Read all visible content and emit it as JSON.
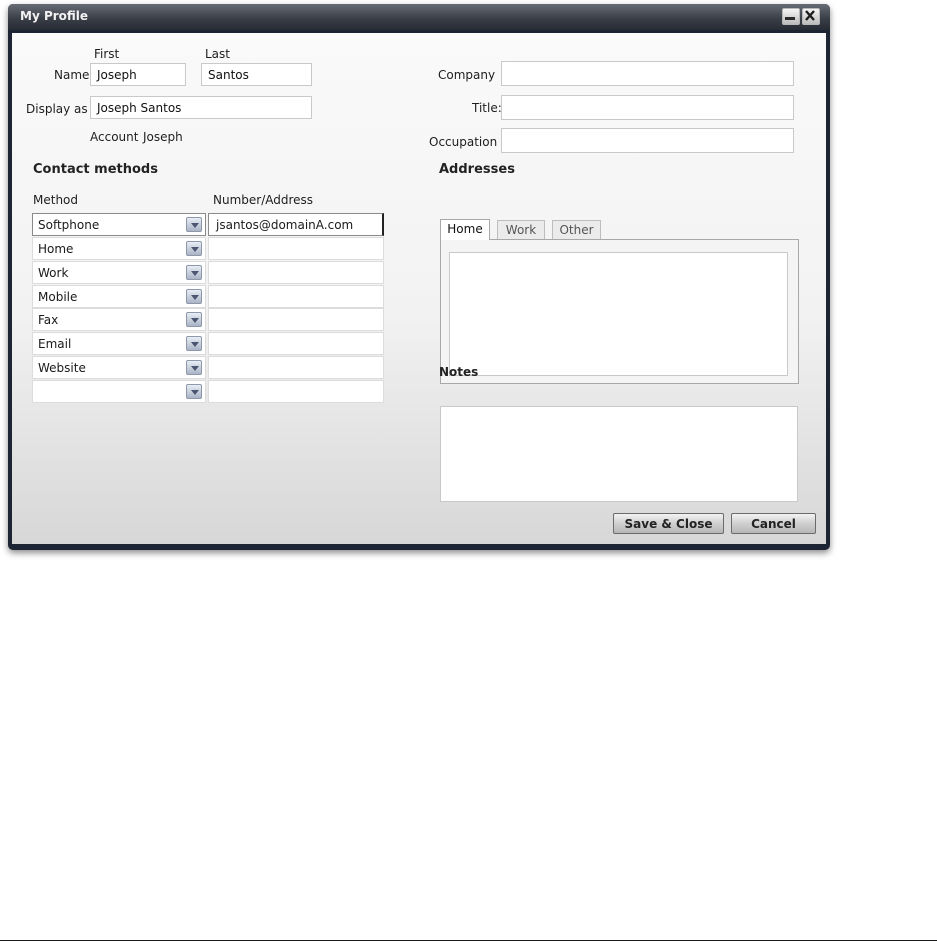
{
  "window": {
    "title": "My Profile"
  },
  "name": {
    "label": "Name",
    "first_label": "First",
    "last_label": "Last",
    "first_value": "Joseph",
    "last_value": "Santos"
  },
  "display_as": {
    "label": "Display as",
    "value": "Joseph Santos"
  },
  "account": {
    "label": "Account",
    "value": "Joseph"
  },
  "company": {
    "label": "Company",
    "value": ""
  },
  "title_field": {
    "label": "Title:",
    "value": ""
  },
  "occupation": {
    "label": "Occupation",
    "value": ""
  },
  "contact_methods": {
    "heading": "Contact methods",
    "col_method": "Method",
    "col_address": "Number/Address",
    "rows": [
      {
        "method": "Softphone",
        "address": "jsantos@domainA.com"
      },
      {
        "method": "Home",
        "address": ""
      },
      {
        "method": "Work",
        "address": ""
      },
      {
        "method": "Mobile",
        "address": ""
      },
      {
        "method": "Fax",
        "address": ""
      },
      {
        "method": "Email",
        "address": ""
      },
      {
        "method": "Website",
        "address": ""
      },
      {
        "method": "",
        "address": ""
      }
    ]
  },
  "addresses": {
    "heading": "Addresses",
    "tabs": [
      "Home",
      "Work",
      "Other"
    ],
    "active_tab": "Home"
  },
  "notes": {
    "heading": "Notes",
    "value": ""
  },
  "buttons": {
    "save": "Save & Close",
    "cancel": "Cancel"
  }
}
